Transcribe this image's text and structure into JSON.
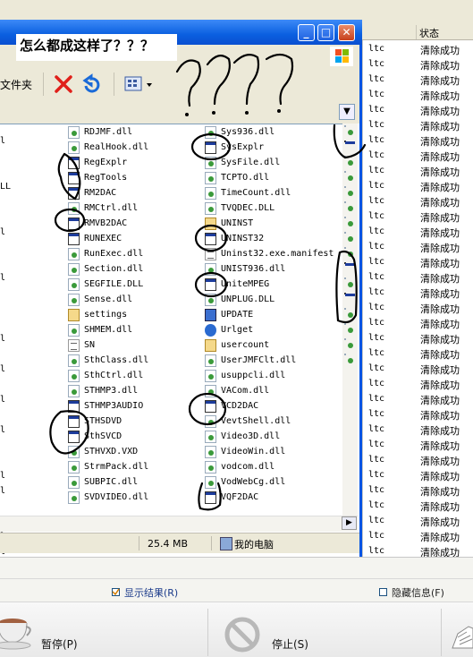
{
  "annotation": {
    "caption": "怎么都成这样了？？？",
    "scribble_text": "????"
  },
  "background_table": {
    "header_status": "状态",
    "rows": [
      {
        "ext": "ltc",
        "status": "清除成功"
      },
      {
        "ext": "ltc",
        "status": "清除成功"
      },
      {
        "ext": "ltc",
        "status": "清除成功"
      },
      {
        "ext": "ltc",
        "status": "清除成功"
      },
      {
        "ext": "ltc",
        "status": "清除成功"
      },
      {
        "ext": "ltc",
        "status": "清除成功"
      },
      {
        "ext": "ltc",
        "status": "清除成功"
      },
      {
        "ext": "ltc",
        "status": "清除成功"
      },
      {
        "ext": "ltc",
        "status": "清除成功"
      },
      {
        "ext": "ltc",
        "status": "清除成功"
      },
      {
        "ext": "ltc",
        "status": "清除成功"
      },
      {
        "ext": "ltc",
        "status": "清除成功"
      },
      {
        "ext": "ltc",
        "status": "清除成功"
      },
      {
        "ext": "ltc",
        "status": "清除成功"
      },
      {
        "ext": "ltc",
        "status": "清除成功"
      },
      {
        "ext": "ltc",
        "status": "清除成功"
      },
      {
        "ext": "ltc",
        "status": "清除成功"
      },
      {
        "ext": "ltc",
        "status": "清除成功"
      },
      {
        "ext": "ltc",
        "status": "清除成功"
      },
      {
        "ext": "ltc",
        "status": "清除成功"
      },
      {
        "ext": "ltc",
        "status": "清除成功"
      },
      {
        "ext": "ltc",
        "status": "清除成功"
      },
      {
        "ext": "ltc",
        "status": "清除成功"
      },
      {
        "ext": "ltc",
        "status": "清除成功"
      },
      {
        "ext": "ltc",
        "status": "清除成功"
      },
      {
        "ext": "ltc",
        "status": "清除成功"
      },
      {
        "ext": "ltc",
        "status": "清除成功"
      },
      {
        "ext": "ltc",
        "status": "清除成功"
      },
      {
        "ext": "ltc",
        "status": "清除成功"
      },
      {
        "ext": "ltc",
        "status": "清除成功"
      },
      {
        "ext": "ltc",
        "status": "清除成功"
      },
      {
        "ext": "ltc",
        "status": "清除成功"
      },
      {
        "ext": "ltc",
        "status": "清除成功"
      },
      {
        "ext": "ltc",
        "status": "清除成功"
      },
      {
        "ext": "ltc",
        "status": "清除成功"
      }
    ]
  },
  "explorer": {
    "toolbar": {
      "folders_label": "文件夹",
      "delete_icon": "red-x-icon",
      "undo_icon": "undo-arrow-icon",
      "views_icon": "views-icon"
    },
    "status": {
      "size": "25.4 MB",
      "location": "我的电脑"
    },
    "left_fragments": [
      "l",
      "LL",
      "l",
      "l",
      "l",
      "l",
      "l",
      "l",
      "l",
      "l",
      "l",
      "l",
      "l",
      "qts",
      "s"
    ],
    "columns": [
      [
        {
          "name": "RDJMF.dll",
          "icon": "dll"
        },
        {
          "name": "RealHook.dll",
          "icon": "dll"
        },
        {
          "name": "RegExplr",
          "icon": "exe"
        },
        {
          "name": "RegTools",
          "icon": "exe"
        },
        {
          "name": "RM2DAC",
          "icon": "exe"
        },
        {
          "name": "RMCtrl.dll",
          "icon": "dll"
        },
        {
          "name": "RMVB2DAC",
          "icon": "exe"
        },
        {
          "name": "RUNEXEC",
          "icon": "exe"
        },
        {
          "name": "RunExec.dll",
          "icon": "dll"
        },
        {
          "name": "Section.dll",
          "icon": "dll"
        },
        {
          "name": "SEGFILE.DLL",
          "icon": "dll"
        },
        {
          "name": "Sense.dll",
          "icon": "dll"
        },
        {
          "name": "settings",
          "icon": "setup"
        },
        {
          "name": "SHMEM.dll",
          "icon": "dll"
        },
        {
          "name": "SN",
          "icon": "txt"
        },
        {
          "name": "SthClass.dll",
          "icon": "dll"
        },
        {
          "name": "SthCtrl.dll",
          "icon": "dll"
        },
        {
          "name": "STHMP3.dll",
          "icon": "dll"
        },
        {
          "name": "STHMP3AUDIO",
          "icon": "exe"
        },
        {
          "name": "STHSDVD",
          "icon": "exe"
        },
        {
          "name": "SthSVCD",
          "icon": "exe"
        },
        {
          "name": "STHVXD.VXD",
          "icon": "dll"
        },
        {
          "name": "StrmPack.dll",
          "icon": "dll"
        },
        {
          "name": "SUBPIC.dll",
          "icon": "dll"
        },
        {
          "name": "SVDVIDEO.dll",
          "icon": "dll"
        }
      ],
      [
        {
          "name": "Sys936.dll",
          "icon": "dll"
        },
        {
          "name": "SysExplr",
          "icon": "exe"
        },
        {
          "name": "SysFile.dll",
          "icon": "dll"
        },
        {
          "name": "TCPTO.dll",
          "icon": "dll"
        },
        {
          "name": "TimeCount.dll",
          "icon": "dll"
        },
        {
          "name": "TVQDEC.DLL",
          "icon": "dll"
        },
        {
          "name": "UNINST",
          "icon": "setup"
        },
        {
          "name": "UNINST32",
          "icon": "exe"
        },
        {
          "name": "Uninst32.exe.manifest",
          "icon": "txt"
        },
        {
          "name": "UNIST936.dll",
          "icon": "dll"
        },
        {
          "name": "UniteMPEG",
          "icon": "exe"
        },
        {
          "name": "UNPLUG.DLL",
          "icon": "dll"
        },
        {
          "name": "UPDATE",
          "icon": "upd"
        },
        {
          "name": "Urlget",
          "icon": "ie"
        },
        {
          "name": "usercount",
          "icon": "setup"
        },
        {
          "name": "UserJMFClt.dll",
          "icon": "dll"
        },
        {
          "name": "usuppcli.dll",
          "icon": "dll"
        },
        {
          "name": "VACom.dll",
          "icon": "dll"
        },
        {
          "name": "VCD2DAC",
          "icon": "exe"
        },
        {
          "name": "VevtShell.dll",
          "icon": "dll"
        },
        {
          "name": "Video3D.dll",
          "icon": "dll"
        },
        {
          "name": "VideoWin.dll",
          "icon": "dll"
        },
        {
          "name": "vodcom.dll",
          "icon": "dll"
        },
        {
          "name": "VodWebCg.dll",
          "icon": "dll"
        },
        {
          "name": "VQF2DAC",
          "icon": "exe"
        }
      ]
    ]
  },
  "bottom": {
    "show_results": "显示结果(R)",
    "hide_info": "隐藏信息(F)",
    "pause": "暂停(P)",
    "stop": "停止(S)"
  }
}
